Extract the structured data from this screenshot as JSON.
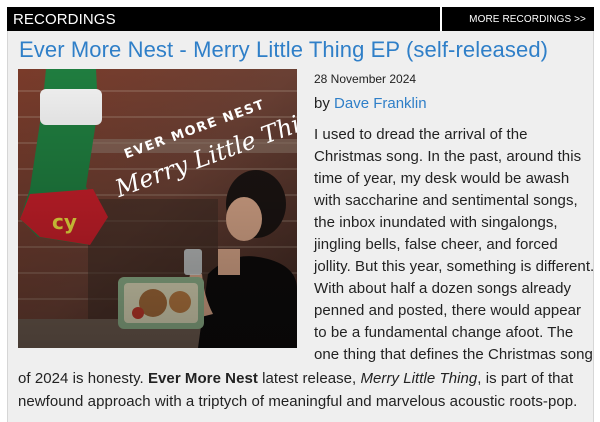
{
  "section": {
    "title": "RECORDINGS",
    "more_link": "MORE RECORDINGS >>"
  },
  "article": {
    "title": "Ever More Nest - Merry Little Thing EP (self-released)",
    "date": "28 November 2024",
    "by_prefix": "by",
    "author": "Dave Franklin",
    "cover": {
      "band_text": "EVER MORE NEST",
      "album_text": "Merry Little Thing"
    },
    "body_lines": [
      "I used to dread the arrival of the",
      "Christmas song. In the past, around this",
      "time of year, my desk would be awash",
      "with saccharine and sentimental songs,",
      "the inbox inundated with singalongs,",
      "jingling bells, false cheer, and forced",
      "jollity. But this year, something is different.",
      "With about half a dozen songs already",
      "penned and posted, there would appear",
      "to be a fundamental change afoot. The",
      "one thing that defines the Christmas song"
    ],
    "line12": {
      "a": "of 2024 is honesty. ",
      "b": "Ever More Nest",
      "c": " latest release, ",
      "d": "Merry Little Thing",
      "e": ", is part of that"
    },
    "line13": "newfound approach with a triptych of meaningful and marvelous acoustic roots-pop."
  }
}
